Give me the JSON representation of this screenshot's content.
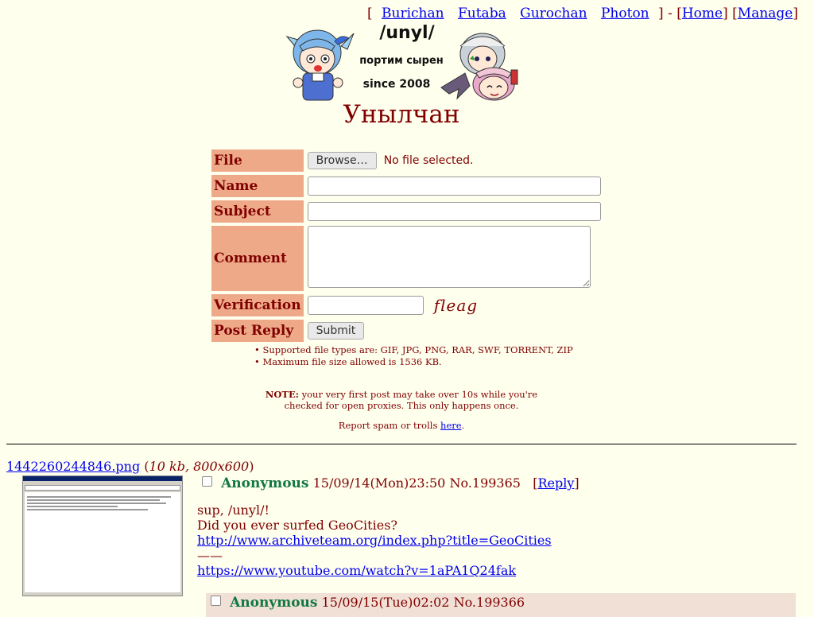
{
  "nav": {
    "boards": [
      "Burichan",
      "Futaba",
      "Gurochan",
      "Photon"
    ],
    "home": "Home",
    "manage": "Manage"
  },
  "banner": {
    "line1": "/unyl/",
    "line2": "портим сырен",
    "line3": "since 2008"
  },
  "board_title": "Унылчан",
  "form": {
    "file_label": "File",
    "browse_label": "Browse…",
    "no_file": "No file selected.",
    "name_label": "Name",
    "subject_label": "Subject",
    "comment_label": "Comment",
    "verification_label": "Verification",
    "captcha_text": "fleag",
    "post_label": "Post Reply",
    "submit_label": "Submit"
  },
  "rules": [
    "Supported file types are: GIF, JPG, PNG, RAR, SWF, TORRENT, ZIP",
    "Maximum file size allowed is 1536 KB."
  ],
  "note": {
    "label": "NOTE:",
    "line1": "your very first post may take over 10s while you're",
    "line2": "checked for open proxies. This only happens once."
  },
  "report": {
    "text": "Report spam or trolls",
    "link": "here",
    "end": "."
  },
  "thread": {
    "file_name": "1442260244846.png",
    "file_meta": "10 kb, 800x600",
    "op": {
      "name": "Anonymous",
      "date": "15/09/14(Mon)23:50",
      "number": "No.199365",
      "reply_label": "Reply",
      "lines": [
        "sup, /unyl/!",
        "Did you ever surfed GeoCities?"
      ],
      "link1": "http://www.archiveteam.org/index.php?title=GeoCities",
      "divider": "——",
      "link2": "https://www.youtube.com/watch?v=1aPA1Q24fak"
    },
    "reply1": {
      "name": "Anonymous",
      "date": "15/09/15(Tue)02:02",
      "number": "No.199366"
    }
  }
}
